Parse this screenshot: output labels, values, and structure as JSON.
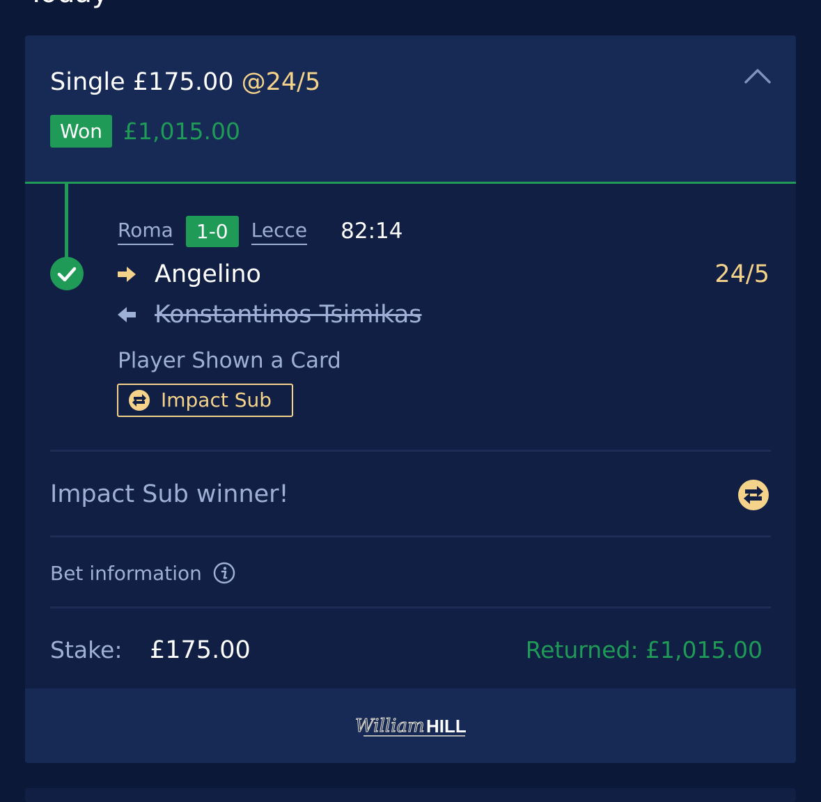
{
  "page": {
    "day_heading": "Today"
  },
  "bet": {
    "type": "Single",
    "stake_header": "£175.00",
    "odds": "@24/5",
    "status": "Won",
    "won_amount": "£1,015.00"
  },
  "selection": {
    "home_team": "Roma",
    "score": "1-0",
    "away_team": "Lecce",
    "match_clock": "82:14",
    "player_in": "Angelino",
    "player_out": "Konstantinos Tsimikas",
    "odds": "24/5",
    "market": "Player Shown a Card",
    "tag": "Impact Sub"
  },
  "summary": {
    "impact_message": "Impact Sub winner!",
    "bet_information_label": "Bet information",
    "stake_label": "Stake:",
    "stake_value": "£175.00",
    "returned_text": "Returned: £1,015.00"
  },
  "footer": {
    "brand": "William HILL",
    "brand_script": "William",
    "brand_caps": "HILL"
  },
  "colors": {
    "background": "#0b1838",
    "card": "#111f44",
    "card_header": "#172a56",
    "accent_green": "#1f9a57",
    "odds_gold": "#f6d38a",
    "muted_text": "#9fb0d6",
    "text": "#ffffff"
  },
  "icons": {
    "collapse": "chevron-up-icon",
    "status": "check-circle-icon",
    "player_in": "arrow-right-icon",
    "player_out": "arrow-left-icon",
    "impact_sub": "swap-arrows-icon",
    "info": "info-circle-icon"
  }
}
